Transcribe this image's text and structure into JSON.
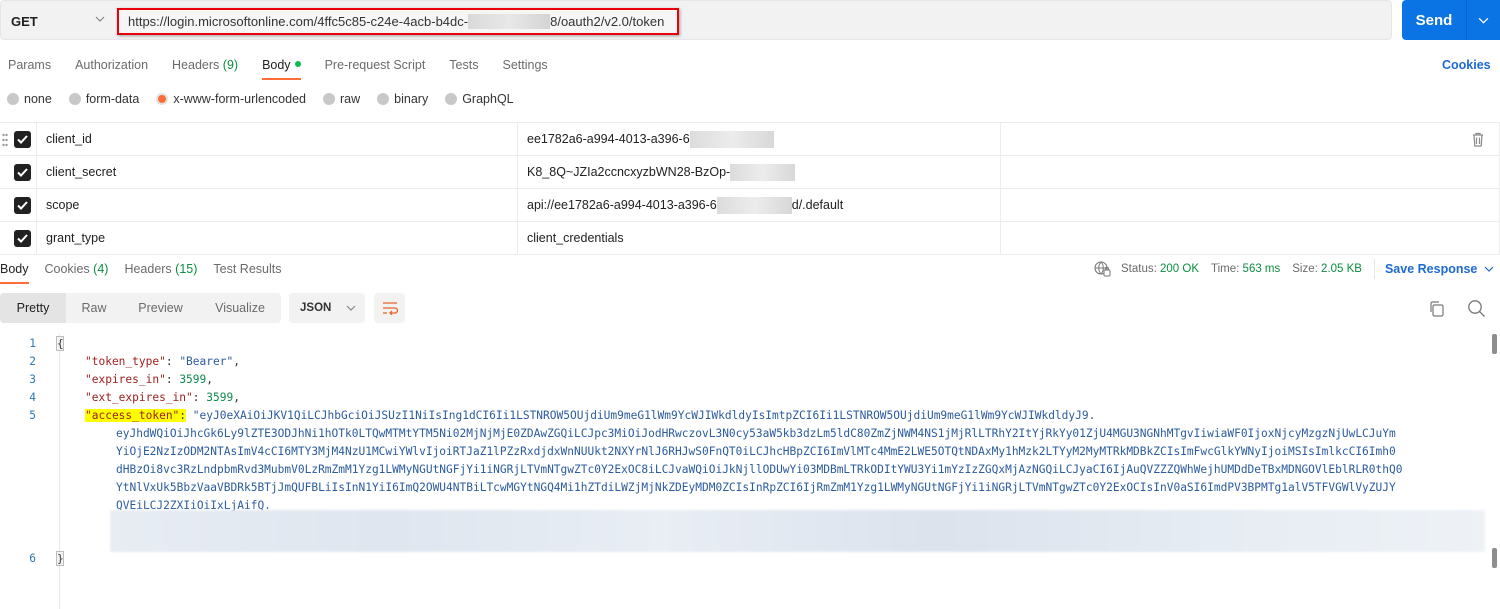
{
  "request": {
    "method": "GET",
    "url_prefix": "https://login.microsoftonline.com/4ffc5c85-c24e-4acb-b4dc-",
    "url_suffix": "8/oauth2/v2.0/token",
    "send_label": "Send"
  },
  "request_tabs": [
    {
      "label": "Params",
      "count": ""
    },
    {
      "label": "Authorization",
      "count": ""
    },
    {
      "label": "Headers",
      "count": "(9)"
    },
    {
      "label": "Body",
      "count": "",
      "active": true,
      "modified": true
    },
    {
      "label": "Pre-request Script",
      "count": ""
    },
    {
      "label": "Tests",
      "count": ""
    },
    {
      "label": "Settings",
      "count": ""
    }
  ],
  "cookies_link": "Cookies",
  "body_types": [
    {
      "label": "none",
      "selected": false
    },
    {
      "label": "form-data",
      "selected": false
    },
    {
      "label": "x-www-form-urlencoded",
      "selected": true
    },
    {
      "label": "raw",
      "selected": false
    },
    {
      "label": "binary",
      "selected": false
    },
    {
      "label": "GraphQL",
      "selected": false
    }
  ],
  "params": [
    {
      "checked": true,
      "key": "client_id",
      "value": "ee1782a6-a994-4013-a396-6",
      "value_after_redaction": ""
    },
    {
      "checked": true,
      "key": "client_secret",
      "value": "K8_8Q~JZIa2ccncxyzbWN28-BzOp-",
      "value_after_redaction": ""
    },
    {
      "checked": true,
      "key": "scope",
      "value": "api://ee1782a6-a994-4013-a396-6",
      "value_after_redaction": "d/.default"
    },
    {
      "checked": true,
      "key": "grant_type",
      "value": "client_credentials",
      "value_after_redaction": ""
    }
  ],
  "response_tabs": [
    {
      "label": "Body",
      "count": "",
      "active": true
    },
    {
      "label": "Cookies",
      "count": "(4)"
    },
    {
      "label": "Headers",
      "count": "(15)"
    },
    {
      "label": "Test Results",
      "count": ""
    }
  ],
  "response_meta": {
    "status_label": "Status:",
    "status_value": "200 OK",
    "time_label": "Time:",
    "time_value": "563 ms",
    "size_label": "Size:",
    "size_value": "2.05 KB",
    "save_response": "Save Response"
  },
  "view_modes": [
    "Pretty",
    "Raw",
    "Preview",
    "Visualize"
  ],
  "active_view_mode": "Pretty",
  "format": "JSON",
  "code": {
    "line_numbers": [
      "1",
      "2",
      "3",
      "4",
      "5",
      "6"
    ],
    "open_brace": "{",
    "close_brace": "}",
    "token_type_key": "\"token_type\"",
    "token_type_value": "\"Bearer\"",
    "expires_in_key": "\"expires_in\"",
    "expires_in_value": "3599",
    "ext_expires_in_key": "\"ext_expires_in\"",
    "ext_expires_in_value": "3599",
    "access_token_key": "\"access_token\"",
    "access_token_lines": [
      "\"eyJ0eXAiOiJKV1QiLCJhbGciOiJSUzI1NiIsIng1dCI6Ii1LSTNROW5OUjdiUm9meG1lWm9YcWJIWkdldyIsImtpZCI6Ii1LSTNROW5OUjdiUm9meG1lWm9YcWJIWkdldyJ9.",
      "eyJhdWQiOiJhcGk6Ly9lZTE3ODJhNi1hOTk0LTQwMTMtYTM5Ni02MjNjMjE0ZDAwZGQiLCJpc3MiOiJodHRwczovL3N0cy53aW5kb3dzLm5ldC80ZmZjNWM4NS1jMjRlLTRhY2ItYjRkYy01ZjU4MGU3NGNhMTgvIiwiaWF0IjoxNjcyMzgzNjUwLCJuYm",
      "YiOjE2NzIzODM2NTAsImV4cCI6MTY3MjM4NzU1MCwiYWlvIjoiRTJaZ1lPZzRxdjdxWnNUUkt2NXYrNlJ6RHJwS0FnQT0iLCJhcHBpZCI6ImVlMTc4MmE2LWE5OTQtNDAxMy1hMzk2LTYyM2MyMTRkMDBkZCIsImFwcGlkYWNyIjoiMSIsImlkcCI6Imh0",
      "dHBzOi8vc3RzLndpbmRvd3MubmV0LzRmZmM1Yzg1LWMyNGUtNGFjYi1iNGRjLTVmNTgwZTc0Y2ExOC8iLCJvaWQiOiJkNjllODUwYi03MDBmLTRkODItYWU3Yi1mYzIzZGQxMjAzNGQiLCJyaCI6IjAuQVZZZQWhWejhUMDdDeTBxMDNGOVlEblRLR0thQ0",
      "YtNlVxUk5BbzVaaVBDRk5BTjJmQUFBLiIsInN1YiI6ImQ2OWU4NTBiLTcwMGYtNGQ4Mi1hZTdiLWZjMjNkZDEyMDM0ZCIsInRpZCI6IjRmZmM1Yzg1LWMyNGUtNGFjYi1iNGRjLTVmNTgwZTc0Y2ExOCIsInV0aSI6ImdPV3BPMTg1alV5TFVGWlVyZUJY",
      "QVEiLCJ2ZXIiOiIxLjAifQ."
    ]
  }
}
